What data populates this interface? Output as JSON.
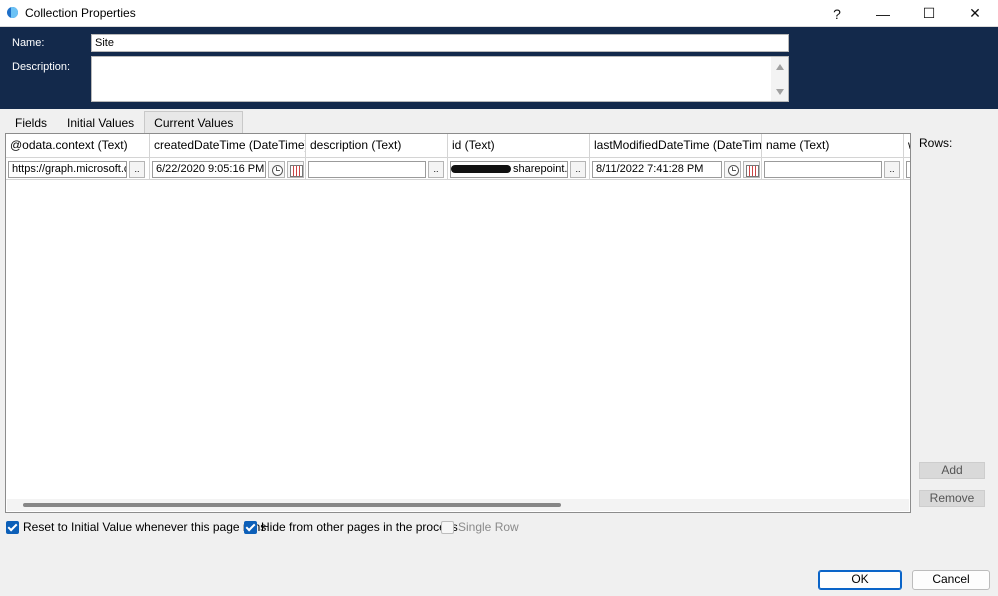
{
  "window": {
    "title": "Collection Properties",
    "help_glyph": "?",
    "minimize_glyph": "—",
    "maximize_glyph": "☐",
    "close_glyph": "✕"
  },
  "header": {
    "name_label": "Name:",
    "name_value": "Site",
    "description_label": "Description:",
    "description_value": ""
  },
  "tabs": [
    {
      "label": "Fields",
      "active": false
    },
    {
      "label": "Initial Values",
      "active": false
    },
    {
      "label": "Current Values",
      "active": true
    }
  ],
  "grid": {
    "columns": [
      {
        "label": "@odata.context  (Text)"
      },
      {
        "label": "createdDateTime  (DateTime)"
      },
      {
        "label": "description  (Text)"
      },
      {
        "label": "id  (Text)"
      },
      {
        "label": "lastModifiedDateTime  (DateTime)"
      },
      {
        "label": "name  (Text)"
      },
      {
        "label": "w"
      }
    ],
    "row": {
      "odata_context": "https://graph.microsoft.co",
      "created": "6/22/2020 9:05:16 PM",
      "description": "",
      "id": "sharepoint.co",
      "last_modified": "8/11/2022 7:41:28 PM",
      "name": "",
      "ellipsis": ".."
    }
  },
  "side": {
    "rows_label": "Rows:",
    "add_label": "Add",
    "remove_label": "Remove"
  },
  "options": {
    "reset_label": "Reset to Initial Value whenever this page runs",
    "reset_checked": true,
    "hide_label": "Hide from other pages in the process",
    "hide_checked": true,
    "single_row_label": "Single Row",
    "single_row_checked": false
  },
  "footer": {
    "ok_label": "OK",
    "cancel_label": "Cancel"
  },
  "colors": {
    "header_bg": "#13294b",
    "accent": "#0c5fb8"
  }
}
